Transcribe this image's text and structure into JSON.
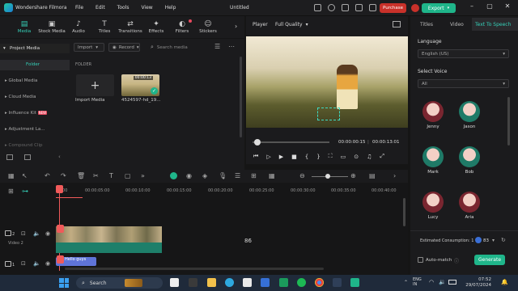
{
  "title_bar": {
    "app_name": "Wondershare Filmora",
    "menus": [
      "File",
      "Edit",
      "Tools",
      "View",
      "Help"
    ],
    "doc_title": "Untitled",
    "purchase": "Purchase",
    "export": "Export"
  },
  "toolbar": {
    "items": [
      "Media",
      "Stock Media",
      "Audio",
      "Titles",
      "Transitions",
      "Effects",
      "Filters",
      "Stickers"
    ]
  },
  "left_nav": {
    "project_media": "Project Media",
    "folder": "Folder",
    "items": [
      "Global Media",
      "Cloud Media",
      "Influence Kit",
      "Adjustment La...",
      "Compound Clip"
    ],
    "new_badge": "NEW"
  },
  "media": {
    "import_dd": "Import",
    "record_dd": "Record",
    "search_placeholder": "Search media",
    "folder_label": "FOLDER",
    "import_tile": "Import Media",
    "clip_name": "4524597-hd_19...",
    "clip_duration": "00:00:13"
  },
  "player": {
    "label": "Player",
    "quality": "Full Quality",
    "current_time": "00:00:00:15",
    "total_time": "00:00:13:01"
  },
  "right_panel": {
    "tabs": [
      "Titles",
      "Video",
      "Text To Speech"
    ],
    "language_label": "Language",
    "language_value": "English (US)",
    "voice_label": "Select Voice",
    "voice_filter": "All",
    "voices": [
      "Jenny",
      "Jason",
      "Mark",
      "Bob",
      "Lucy",
      "Aria"
    ],
    "consumption_label": "Estimated Consumption: 1",
    "credits": "83",
    "automatch": "Auto-match",
    "generate": "Generate"
  },
  "timeline": {
    "ticks": [
      "00:00",
      "00:00:05:00",
      "00:00:10:00",
      "00:00:15:00",
      "00:00:20:00",
      "00:00:25:00",
      "00:00:30:00",
      "00:00:35:00",
      "00:00:40:00"
    ],
    "track2_label": "Video 2",
    "track_num_2": "2",
    "track_num_1": "1",
    "text_clip": "Hello guys",
    "center_number": "86"
  },
  "taskbar": {
    "search": "Search",
    "time": "07:52",
    "date": "29/07/2024",
    "lang": "ENG",
    "lang2": "IN"
  },
  "colors": {
    "accent": "#35d0b8",
    "export": "#1fb58a",
    "purchase": "#c9312a",
    "playhead": "#f05a5a"
  }
}
